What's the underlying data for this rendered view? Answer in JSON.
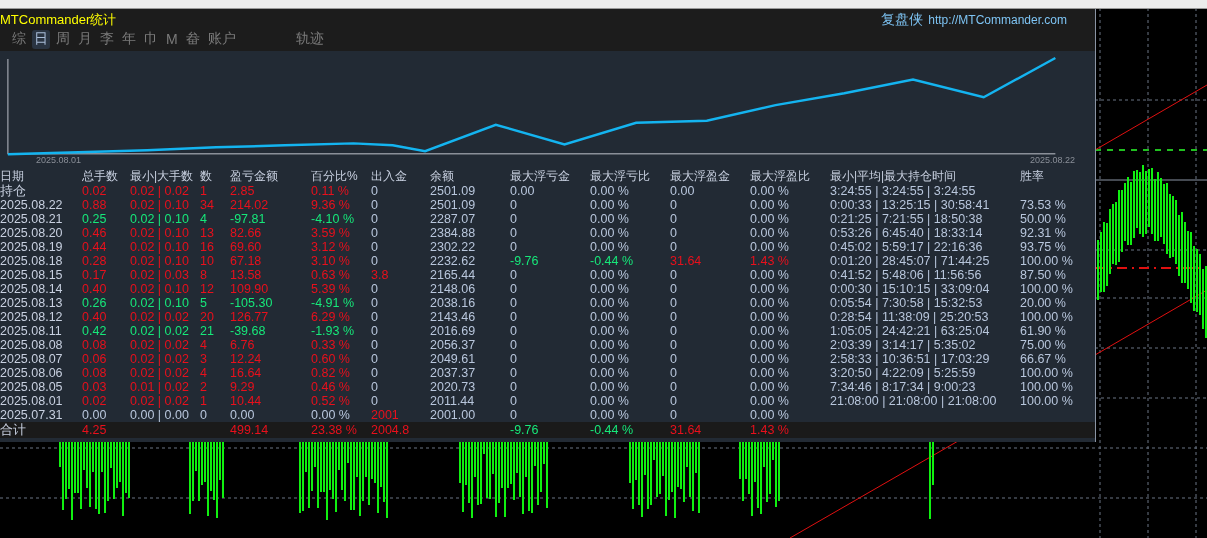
{
  "window": {
    "title": "MTCommander统计",
    "brand": "复盘侠",
    "link": "http://MTCommander.com"
  },
  "tabs": [
    {
      "label": "综",
      "selected": false
    },
    {
      "label": "日",
      "selected": true
    },
    {
      "label": "周",
      "selected": false
    },
    {
      "label": "月",
      "selected": false
    },
    {
      "label": "李",
      "selected": false
    },
    {
      "label": "年",
      "selected": false
    },
    {
      "label": "巾",
      "selected": false
    },
    {
      "label": "M",
      "selected": false
    },
    {
      "label": "畚",
      "selected": false
    },
    {
      "label": "账户",
      "selected": false
    }
  ],
  "trace_button": "轨迹",
  "equity_chart": {
    "start_label": "2025.08.01",
    "end_label": "2025.08.22"
  },
  "table": {
    "date_column": "日期",
    "columns": [
      "总手数",
      "最小|大手数",
      "数",
      "盈亏金额",
      "百分比%",
      "出入金",
      "余额",
      "最大浮亏金",
      "最大浮亏比",
      "最大浮盈金",
      "最大浮盈比",
      "最小|平均|最大持仓时间",
      "胜率"
    ],
    "rows": [
      {
        "date": "持仓",
        "cells": [
          {
            "text": "0.02",
            "color": "#e8101c"
          },
          {
            "text": "0.02 | 0.02",
            "color": "#e8101c"
          },
          {
            "text": "1",
            "color": "#e8101c"
          },
          {
            "text": "2.85",
            "color": "#e8101c"
          },
          {
            "text": "0.11 %",
            "color": "#e8101c"
          },
          {
            "text": "0",
            "color": "#b8c6dc"
          },
          {
            "text": "2501.09",
            "color": "#b8c6dc"
          },
          {
            "text": "0.00",
            "color": "#b8c6dc"
          },
          {
            "text": "0.00 %",
            "color": "#b8c6dc"
          },
          {
            "text": "0.00",
            "color": "#b8c6dc"
          },
          {
            "text": "0.00 %",
            "color": "#b8c6dc"
          },
          {
            "text": "3:24:55 | 3:24:55 | 3:24:55",
            "color": "#b8c6dc"
          }
        ]
      },
      {
        "date": "2025.08.22",
        "cells": [
          {
            "text": "0.88",
            "color": "#e8101c"
          },
          {
            "text": "0.02 | 0.10",
            "color": "#e8101c"
          },
          {
            "text": "34",
            "color": "#e8101c"
          },
          {
            "text": "214.02",
            "color": "#e8101c"
          },
          {
            "text": "9.36 %",
            "color": "#e8101c"
          },
          {
            "text": "0",
            "color": "#b8c6dc"
          },
          {
            "text": "2501.09",
            "color": "#b8c6dc"
          },
          {
            "text": "0",
            "color": "#b8c6dc"
          },
          {
            "text": "0.00 %",
            "color": "#b8c6dc"
          },
          {
            "text": "0",
            "color": "#b8c6dc"
          },
          {
            "text": "0.00 %",
            "color": "#b8c6dc"
          },
          {
            "text": "0:00:33 | 13:25:15 | 30:58:41",
            "color": "#b8c6dc"
          },
          {
            "text": "73.53 %",
            "color": "#b8c6dc"
          }
        ]
      },
      {
        "date": "2025.08.21",
        "cells": [
          {
            "text": "0.25",
            "color": "#16e87a"
          },
          {
            "text": "0.02 | 0.10",
            "color": "#16e87a"
          },
          {
            "text": "4",
            "color": "#16e87a"
          },
          {
            "text": "-97.81",
            "color": "#16e87a"
          },
          {
            "text": "-4.10 %",
            "color": "#16e87a"
          },
          {
            "text": "0",
            "color": "#b8c6dc"
          },
          {
            "text": "2287.07",
            "color": "#b8c6dc"
          },
          {
            "text": "0",
            "color": "#b8c6dc"
          },
          {
            "text": "0.00 %",
            "color": "#b8c6dc"
          },
          {
            "text": "0",
            "color": "#b8c6dc"
          },
          {
            "text": "0.00 %",
            "color": "#b8c6dc"
          },
          {
            "text": "0:21:25 | 7:21:55 | 18:50:38",
            "color": "#b8c6dc"
          },
          {
            "text": "50.00 %",
            "color": "#b8c6dc"
          }
        ]
      },
      {
        "date": "2025.08.20",
        "cells": [
          {
            "text": "0.46",
            "color": "#e8101c"
          },
          {
            "text": "0.02 | 0.10",
            "color": "#e8101c"
          },
          {
            "text": "13",
            "color": "#e8101c"
          },
          {
            "text": "82.66",
            "color": "#e8101c"
          },
          {
            "text": "3.59 %",
            "color": "#e8101c"
          },
          {
            "text": "0",
            "color": "#b8c6dc"
          },
          {
            "text": "2384.88",
            "color": "#b8c6dc"
          },
          {
            "text": "0",
            "color": "#b8c6dc"
          },
          {
            "text": "0.00 %",
            "color": "#b8c6dc"
          },
          {
            "text": "0",
            "color": "#b8c6dc"
          },
          {
            "text": "0.00 %",
            "color": "#b8c6dc"
          },
          {
            "text": "0:53:26 | 6:45:40 | 18:33:14",
            "color": "#b8c6dc"
          },
          {
            "text": "92.31 %",
            "color": "#b8c6dc"
          }
        ]
      },
      {
        "date": "2025.08.19",
        "cells": [
          {
            "text": "0.44",
            "color": "#e8101c"
          },
          {
            "text": "0.02 | 0.10",
            "color": "#e8101c"
          },
          {
            "text": "16",
            "color": "#e8101c"
          },
          {
            "text": "69.60",
            "color": "#e8101c"
          },
          {
            "text": "3.12 %",
            "color": "#e8101c"
          },
          {
            "text": "0",
            "color": "#b8c6dc"
          },
          {
            "text": "2302.22",
            "color": "#b8c6dc"
          },
          {
            "text": "0",
            "color": "#b8c6dc"
          },
          {
            "text": "0.00 %",
            "color": "#b8c6dc"
          },
          {
            "text": "0",
            "color": "#b8c6dc"
          },
          {
            "text": "0.00 %",
            "color": "#b8c6dc"
          },
          {
            "text": "0:45:02 | 5:59:17 | 22:16:36",
            "color": "#b8c6dc"
          },
          {
            "text": "93.75 %",
            "color": "#b8c6dc"
          }
        ]
      },
      {
        "date": "2025.08.18",
        "cells": [
          {
            "text": "0.28",
            "color": "#e8101c"
          },
          {
            "text": "0.02 | 0.10",
            "color": "#e8101c"
          },
          {
            "text": "10",
            "color": "#e8101c"
          },
          {
            "text": "67.18",
            "color": "#e8101c"
          },
          {
            "text": "3.10 %",
            "color": "#e8101c"
          },
          {
            "text": "0",
            "color": "#b8c6dc"
          },
          {
            "text": "2232.62",
            "color": "#b8c6dc"
          },
          {
            "text": "-9.76",
            "color": "#16e87a"
          },
          {
            "text": "-0.44 %",
            "color": "#16e87a"
          },
          {
            "text": "31.64",
            "color": "#e8101c"
          },
          {
            "text": "1.43 %",
            "color": "#e8101c"
          },
          {
            "text": "0:01:20 | 28:45:07 | 71:44:25",
            "color": "#b8c6dc"
          },
          {
            "text": "100.00 %",
            "color": "#b8c6dc"
          }
        ]
      },
      {
        "date": "2025.08.15",
        "cells": [
          {
            "text": "0.17",
            "color": "#e8101c"
          },
          {
            "text": "0.02 | 0.03",
            "color": "#e8101c"
          },
          {
            "text": "8",
            "color": "#e8101c"
          },
          {
            "text": "13.58",
            "color": "#e8101c"
          },
          {
            "text": "0.63 %",
            "color": "#e8101c"
          },
          {
            "text": "3.8",
            "color": "#e8101c"
          },
          {
            "text": "2165.44",
            "color": "#b8c6dc"
          },
          {
            "text": "0",
            "color": "#b8c6dc"
          },
          {
            "text": "0.00 %",
            "color": "#b8c6dc"
          },
          {
            "text": "0",
            "color": "#b8c6dc"
          },
          {
            "text": "0.00 %",
            "color": "#b8c6dc"
          },
          {
            "text": "0:41:52 | 5:48:06 | 11:56:56",
            "color": "#b8c6dc"
          },
          {
            "text": "87.50 %",
            "color": "#b8c6dc"
          }
        ]
      },
      {
        "date": "2025.08.14",
        "cells": [
          {
            "text": "0.40",
            "color": "#e8101c"
          },
          {
            "text": "0.02 | 0.10",
            "color": "#e8101c"
          },
          {
            "text": "12",
            "color": "#e8101c"
          },
          {
            "text": "109.90",
            "color": "#e8101c"
          },
          {
            "text": "5.39 %",
            "color": "#e8101c"
          },
          {
            "text": "0",
            "color": "#b8c6dc"
          },
          {
            "text": "2148.06",
            "color": "#b8c6dc"
          },
          {
            "text": "0",
            "color": "#b8c6dc"
          },
          {
            "text": "0.00 %",
            "color": "#b8c6dc"
          },
          {
            "text": "0",
            "color": "#b8c6dc"
          },
          {
            "text": "0.00 %",
            "color": "#b8c6dc"
          },
          {
            "text": "0:00:30 | 15:10:15 | 33:09:04",
            "color": "#b8c6dc"
          },
          {
            "text": "100.00 %",
            "color": "#b8c6dc"
          }
        ]
      },
      {
        "date": "2025.08.13",
        "cells": [
          {
            "text": "0.26",
            "color": "#16e87a"
          },
          {
            "text": "0.02 | 0.10",
            "color": "#16e87a"
          },
          {
            "text": "5",
            "color": "#16e87a"
          },
          {
            "text": "-105.30",
            "color": "#16e87a"
          },
          {
            "text": "-4.91 %",
            "color": "#16e87a"
          },
          {
            "text": "0",
            "color": "#b8c6dc"
          },
          {
            "text": "2038.16",
            "color": "#b8c6dc"
          },
          {
            "text": "0",
            "color": "#b8c6dc"
          },
          {
            "text": "0.00 %",
            "color": "#b8c6dc"
          },
          {
            "text": "0",
            "color": "#b8c6dc"
          },
          {
            "text": "0.00 %",
            "color": "#b8c6dc"
          },
          {
            "text": "0:05:54 | 7:30:58 | 15:32:53",
            "color": "#b8c6dc"
          },
          {
            "text": "20.00 %",
            "color": "#b8c6dc"
          }
        ]
      },
      {
        "date": "2025.08.12",
        "cells": [
          {
            "text": "0.40",
            "color": "#e8101c"
          },
          {
            "text": "0.02 | 0.02",
            "color": "#e8101c"
          },
          {
            "text": "20",
            "color": "#e8101c"
          },
          {
            "text": "126.77",
            "color": "#e8101c"
          },
          {
            "text": "6.29 %",
            "color": "#e8101c"
          },
          {
            "text": "0",
            "color": "#b8c6dc"
          },
          {
            "text": "2143.46",
            "color": "#b8c6dc"
          },
          {
            "text": "0",
            "color": "#b8c6dc"
          },
          {
            "text": "0.00 %",
            "color": "#b8c6dc"
          },
          {
            "text": "0",
            "color": "#b8c6dc"
          },
          {
            "text": "0.00 %",
            "color": "#b8c6dc"
          },
          {
            "text": "0:28:54 | 11:38:09 | 25:20:53",
            "color": "#b8c6dc"
          },
          {
            "text": "100.00 %",
            "color": "#b8c6dc"
          }
        ]
      },
      {
        "date": "2025.08.11",
        "cells": [
          {
            "text": "0.42",
            "color": "#16e87a"
          },
          {
            "text": "0.02 | 0.02",
            "color": "#16e87a"
          },
          {
            "text": "21",
            "color": "#16e87a"
          },
          {
            "text": "-39.68",
            "color": "#16e87a"
          },
          {
            "text": "-1.93 %",
            "color": "#16e87a"
          },
          {
            "text": "0",
            "color": "#b8c6dc"
          },
          {
            "text": "2016.69",
            "color": "#b8c6dc"
          },
          {
            "text": "0",
            "color": "#b8c6dc"
          },
          {
            "text": "0.00 %",
            "color": "#b8c6dc"
          },
          {
            "text": "0",
            "color": "#b8c6dc"
          },
          {
            "text": "0.00 %",
            "color": "#b8c6dc"
          },
          {
            "text": "1:05:05 | 24:42:21 | 63:25:04",
            "color": "#b8c6dc"
          },
          {
            "text": "61.90 %",
            "color": "#b8c6dc"
          }
        ]
      },
      {
        "date": "2025.08.08",
        "cells": [
          {
            "text": "0.08",
            "color": "#e8101c"
          },
          {
            "text": "0.02 | 0.02",
            "color": "#e8101c"
          },
          {
            "text": "4",
            "color": "#e8101c"
          },
          {
            "text": "6.76",
            "color": "#e8101c"
          },
          {
            "text": "0.33 %",
            "color": "#e8101c"
          },
          {
            "text": "0",
            "color": "#b8c6dc"
          },
          {
            "text": "2056.37",
            "color": "#b8c6dc"
          },
          {
            "text": "0",
            "color": "#b8c6dc"
          },
          {
            "text": "0.00 %",
            "color": "#b8c6dc"
          },
          {
            "text": "0",
            "color": "#b8c6dc"
          },
          {
            "text": "0.00 %",
            "color": "#b8c6dc"
          },
          {
            "text": "2:03:39 | 3:14:17 | 5:35:02",
            "color": "#b8c6dc"
          },
          {
            "text": "75.00 %",
            "color": "#b8c6dc"
          }
        ]
      },
      {
        "date": "2025.08.07",
        "cells": [
          {
            "text": "0.06",
            "color": "#e8101c"
          },
          {
            "text": "0.02 | 0.02",
            "color": "#e8101c"
          },
          {
            "text": "3",
            "color": "#e8101c"
          },
          {
            "text": "12.24",
            "color": "#e8101c"
          },
          {
            "text": "0.60 %",
            "color": "#e8101c"
          },
          {
            "text": "0",
            "color": "#b8c6dc"
          },
          {
            "text": "2049.61",
            "color": "#b8c6dc"
          },
          {
            "text": "0",
            "color": "#b8c6dc"
          },
          {
            "text": "0.00 %",
            "color": "#b8c6dc"
          },
          {
            "text": "0",
            "color": "#b8c6dc"
          },
          {
            "text": "0.00 %",
            "color": "#b8c6dc"
          },
          {
            "text": "2:58:33 | 10:36:51 | 17:03:29",
            "color": "#b8c6dc"
          },
          {
            "text": "66.67 %",
            "color": "#b8c6dc"
          }
        ]
      },
      {
        "date": "2025.08.06",
        "cells": [
          {
            "text": "0.08",
            "color": "#e8101c"
          },
          {
            "text": "0.02 | 0.02",
            "color": "#e8101c"
          },
          {
            "text": "4",
            "color": "#e8101c"
          },
          {
            "text": "16.64",
            "color": "#e8101c"
          },
          {
            "text": "0.82 %",
            "color": "#e8101c"
          },
          {
            "text": "0",
            "color": "#b8c6dc"
          },
          {
            "text": "2037.37",
            "color": "#b8c6dc"
          },
          {
            "text": "0",
            "color": "#b8c6dc"
          },
          {
            "text": "0.00 %",
            "color": "#b8c6dc"
          },
          {
            "text": "0",
            "color": "#b8c6dc"
          },
          {
            "text": "0.00 %",
            "color": "#b8c6dc"
          },
          {
            "text": "3:20:50 | 4:22:09 | 5:25:59",
            "color": "#b8c6dc"
          },
          {
            "text": "100.00 %",
            "color": "#b8c6dc"
          }
        ]
      },
      {
        "date": "2025.08.05",
        "cells": [
          {
            "text": "0.03",
            "color": "#e8101c"
          },
          {
            "text": "0.01 | 0.02",
            "color": "#e8101c"
          },
          {
            "text": "2",
            "color": "#e8101c"
          },
          {
            "text": "9.29",
            "color": "#e8101c"
          },
          {
            "text": "0.46 %",
            "color": "#e8101c"
          },
          {
            "text": "0",
            "color": "#b8c6dc"
          },
          {
            "text": "2020.73",
            "color": "#b8c6dc"
          },
          {
            "text": "0",
            "color": "#b8c6dc"
          },
          {
            "text": "0.00 %",
            "color": "#b8c6dc"
          },
          {
            "text": "0",
            "color": "#b8c6dc"
          },
          {
            "text": "0.00 %",
            "color": "#b8c6dc"
          },
          {
            "text": "7:34:46 | 8:17:34 | 9:00:23",
            "color": "#b8c6dc"
          },
          {
            "text": "100.00 %",
            "color": "#b8c6dc"
          }
        ]
      },
      {
        "date": "2025.08.01",
        "cells": [
          {
            "text": "0.02",
            "color": "#e8101c"
          },
          {
            "text": "0.02 | 0.02",
            "color": "#e8101c"
          },
          {
            "text": "1",
            "color": "#e8101c"
          },
          {
            "text": "10.44",
            "color": "#e8101c"
          },
          {
            "text": "0.52 %",
            "color": "#e8101c"
          },
          {
            "text": "0",
            "color": "#b8c6dc"
          },
          {
            "text": "2011.44",
            "color": "#b8c6dc"
          },
          {
            "text": "0",
            "color": "#b8c6dc"
          },
          {
            "text": "0.00 %",
            "color": "#b8c6dc"
          },
          {
            "text": "0",
            "color": "#b8c6dc"
          },
          {
            "text": "0.00 %",
            "color": "#b8c6dc"
          },
          {
            "text": "21:08:00 | 21:08:00 | 21:08:00",
            "color": "#b8c6dc"
          },
          {
            "text": "100.00 %",
            "color": "#b8c6dc"
          }
        ]
      },
      {
        "date": "2025.07.31",
        "cells": [
          {
            "text": "0.00",
            "color": "#b8c6dc"
          },
          {
            "text": "0.00 | 0.00",
            "color": "#b8c6dc"
          },
          {
            "text": "0",
            "color": "#b8c6dc"
          },
          {
            "text": "0.00",
            "color": "#b8c6dc"
          },
          {
            "text": "0.00 %",
            "color": "#b8c6dc"
          },
          {
            "text": "2001",
            "color": "#e8101c"
          },
          {
            "text": "2001.00",
            "color": "#b8c6dc"
          },
          {
            "text": "0",
            "color": "#b8c6dc"
          },
          {
            "text": "0.00 %",
            "color": "#b8c6dc"
          },
          {
            "text": "0",
            "color": "#b8c6dc"
          },
          {
            "text": "0.00 %",
            "color": "#b8c6dc"
          }
        ]
      }
    ],
    "total": {
      "label": "合计",
      "cells": [
        {
          "text": "4.25",
          "color": "#e8101c"
        },
        {
          "text": ""
        },
        {
          "text": ""
        },
        {
          "text": "499.14",
          "color": "#e8101c"
        },
        {
          "text": "23.38 %",
          "color": "#e8101c"
        },
        {
          "text": "2004.8",
          "color": "#e8101c"
        },
        {
          "text": ""
        },
        {
          "text": "-9.76",
          "color": "#16e87a"
        },
        {
          "text": "-0.44 %",
          "color": "#16e87a"
        },
        {
          "text": "31.64",
          "color": "#e8101c"
        },
        {
          "text": "1.43 %",
          "color": "#e8101c"
        }
      ]
    }
  }
}
